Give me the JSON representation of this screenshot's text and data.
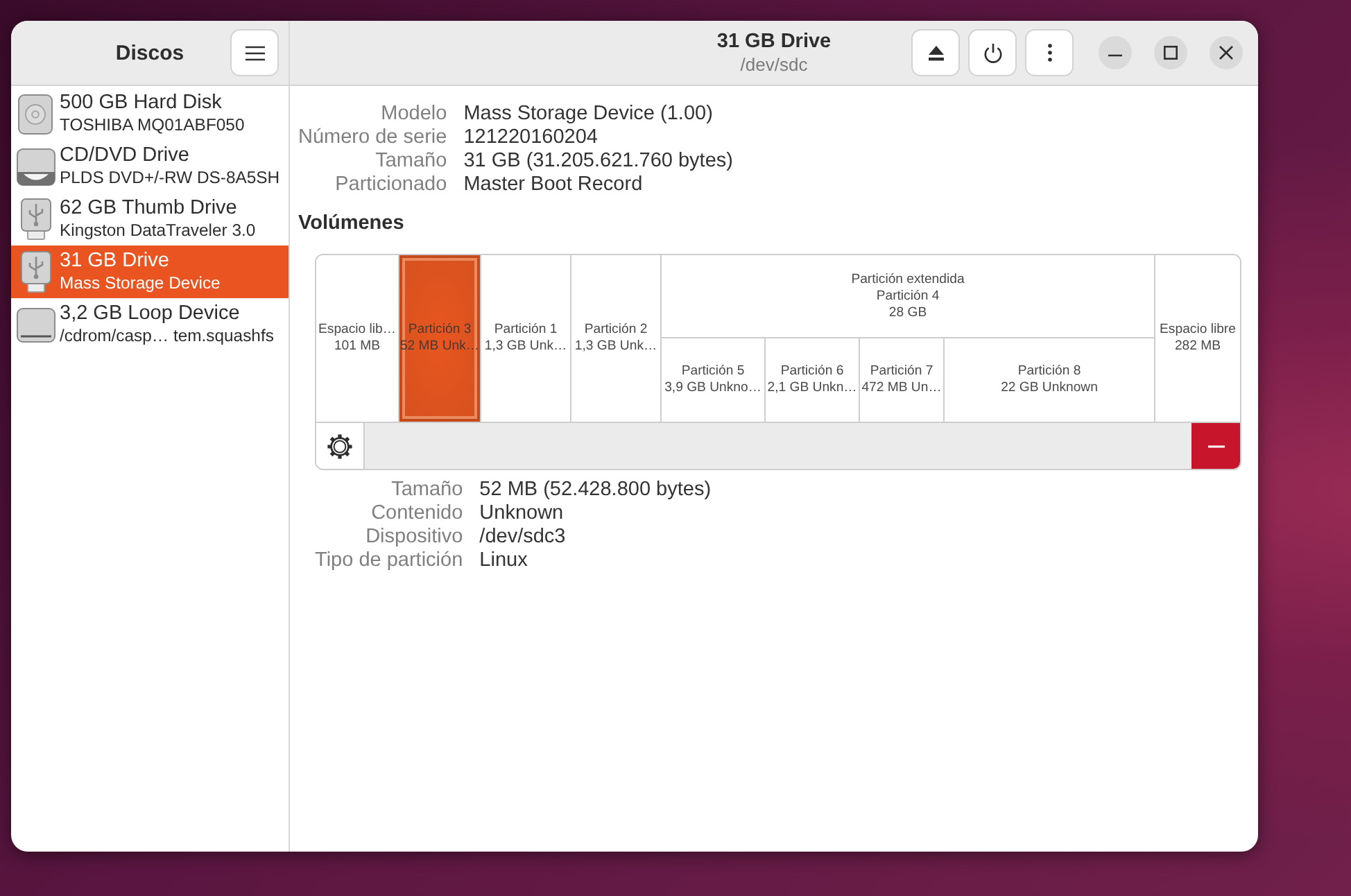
{
  "sidebar": {
    "title": "Discos",
    "items": [
      {
        "kind": "hdd",
        "name": "500 GB Hard Disk",
        "detail": "TOSHIBA MQ01ABF050",
        "selected": false
      },
      {
        "kind": "optical",
        "name": "CD/DVD Drive",
        "detail": "PLDS DVD+/-RW DS-8A5SH",
        "selected": false
      },
      {
        "kind": "usb",
        "name": "62 GB Thumb Drive",
        "detail": "Kingston DataTraveler 3.0",
        "selected": false
      },
      {
        "kind": "usb",
        "name": "31 GB Drive",
        "detail": "Mass Storage Device",
        "selected": true
      },
      {
        "kind": "loop",
        "name": "3,2 GB Loop Device",
        "detail": "/cdrom/casp… tem.squashfs",
        "selected": false
      }
    ]
  },
  "header": {
    "title": "31 GB Drive",
    "subtitle": "/dev/sdc"
  },
  "drive_info": [
    {
      "label": "Modelo",
      "value": "Mass Storage Device (1.00)"
    },
    {
      "label": "Número de serie",
      "value": "121220160204"
    },
    {
      "label": "Tamaño",
      "value": "31 GB (31.205.621.760 bytes)"
    },
    {
      "label": "Particionado",
      "value": "Master Boot Record"
    }
  ],
  "volumes": {
    "heading": "Volúmenes",
    "segments": [
      {
        "kind": "free",
        "name": "Espacio lib…",
        "detail": "101 MB",
        "selected": false
      },
      {
        "kind": "partition",
        "name": "Partición 3",
        "detail": "52 MB Unk…",
        "selected": true
      },
      {
        "kind": "partition",
        "name": "Partición 1",
        "detail": "1,3 GB Unk…",
        "selected": false
      },
      {
        "kind": "partition",
        "name": "Partición 2",
        "detail": "1,3 GB Unk…",
        "selected": false
      },
      {
        "kind": "extended",
        "type": "Partición extendida",
        "name": "Partición 4",
        "detail": "28 GB",
        "selected": false,
        "children": [
          {
            "kind": "partition",
            "name": "Partición 5",
            "detail": "3,9 GB Unkno…",
            "selected": false
          },
          {
            "kind": "partition",
            "name": "Partición 6",
            "detail": "2,1 GB Unkn…",
            "selected": false
          },
          {
            "kind": "partition",
            "name": "Partición 7",
            "detail": "472 MB Un…",
            "selected": false
          },
          {
            "kind": "partition",
            "name": "Partición 8",
            "detail": "22 GB Unknown",
            "selected": false
          }
        ]
      },
      {
        "kind": "free",
        "name": "Espacio libre",
        "detail": "282 MB",
        "selected": false
      }
    ]
  },
  "volume_info": [
    {
      "label": "Tamaño",
      "value": "52 MB (52.428.800 bytes)"
    },
    {
      "label": "Contenido",
      "value": "Unknown"
    },
    {
      "label": "Dispositivo",
      "value": "/dev/sdc3"
    },
    {
      "label": "Tipo de partición",
      "value": "Linux"
    }
  ]
}
